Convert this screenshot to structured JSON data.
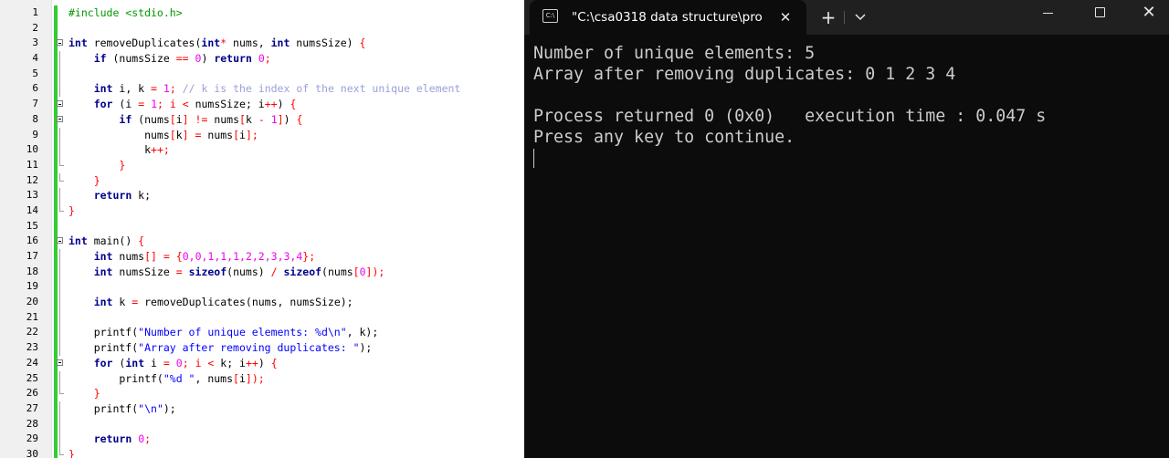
{
  "editor": {
    "lines": [
      {
        "n": "1",
        "fold": "none",
        "tokens": [
          {
            "t": "#include <stdio.h>",
            "c": "pp"
          }
        ]
      },
      {
        "n": "2",
        "fold": "none",
        "tokens": []
      },
      {
        "n": "3",
        "fold": "box",
        "tokens": [
          {
            "t": "int",
            "c": "kw"
          },
          {
            "t": " removeDuplicates(",
            "c": ""
          },
          {
            "t": "int",
            "c": "kw"
          },
          {
            "t": "*",
            "c": "op"
          },
          {
            "t": " nums, ",
            "c": ""
          },
          {
            "t": "int",
            "c": "kw"
          },
          {
            "t": " numsSize) ",
            "c": ""
          },
          {
            "t": "{",
            "c": "op"
          }
        ]
      },
      {
        "n": "4",
        "fold": "line",
        "tokens": [
          {
            "t": "    ",
            "c": ""
          },
          {
            "t": "if",
            "c": "kw"
          },
          {
            "t": " (numsSize ",
            "c": ""
          },
          {
            "t": "==",
            "c": "op"
          },
          {
            "t": " ",
            "c": ""
          },
          {
            "t": "0",
            "c": "num"
          },
          {
            "t": ") ",
            "c": ""
          },
          {
            "t": "return",
            "c": "kw"
          },
          {
            "t": " ",
            "c": ""
          },
          {
            "t": "0",
            "c": "num"
          },
          {
            "t": ";",
            "c": "op"
          }
        ]
      },
      {
        "n": "5",
        "fold": "line",
        "tokens": []
      },
      {
        "n": "6",
        "fold": "line",
        "tokens": [
          {
            "t": "    ",
            "c": ""
          },
          {
            "t": "int",
            "c": "kw"
          },
          {
            "t": " i, k ",
            "c": ""
          },
          {
            "t": "=",
            "c": "op"
          },
          {
            "t": " ",
            "c": ""
          },
          {
            "t": "1",
            "c": "num"
          },
          {
            "t": "; ",
            "c": "op"
          },
          {
            "t": "// k is the index of the next unique element",
            "c": "cm"
          }
        ]
      },
      {
        "n": "7",
        "fold": "box",
        "tokens": [
          {
            "t": "    ",
            "c": ""
          },
          {
            "t": "for",
            "c": "kw"
          },
          {
            "t": " (i ",
            "c": ""
          },
          {
            "t": "=",
            "c": "op"
          },
          {
            "t": " ",
            "c": ""
          },
          {
            "t": "1",
            "c": "num"
          },
          {
            "t": "; i ",
            "c": "op"
          },
          {
            "t": "<",
            "c": "op"
          },
          {
            "t": " numsSize; i",
            "c": ""
          },
          {
            "t": "++",
            "c": "op"
          },
          {
            "t": ") ",
            "c": ""
          },
          {
            "t": "{",
            "c": "op"
          }
        ]
      },
      {
        "n": "8",
        "fold": "box",
        "tokens": [
          {
            "t": "        ",
            "c": ""
          },
          {
            "t": "if",
            "c": "kw"
          },
          {
            "t": " (nums",
            "c": ""
          },
          {
            "t": "[",
            "c": "op"
          },
          {
            "t": "i",
            "c": ""
          },
          {
            "t": "]",
            "c": "op"
          },
          {
            "t": " ",
            "c": ""
          },
          {
            "t": "!=",
            "c": "op"
          },
          {
            "t": " nums",
            "c": ""
          },
          {
            "t": "[",
            "c": "op"
          },
          {
            "t": "k ",
            "c": ""
          },
          {
            "t": "-",
            "c": "op"
          },
          {
            "t": " ",
            "c": ""
          },
          {
            "t": "1",
            "c": "num"
          },
          {
            "t": "]",
            "c": "op"
          },
          {
            "t": ") ",
            "c": ""
          },
          {
            "t": "{",
            "c": "op"
          }
        ]
      },
      {
        "n": "9",
        "fold": "line",
        "tokens": [
          {
            "t": "            nums",
            "c": ""
          },
          {
            "t": "[",
            "c": "op"
          },
          {
            "t": "k",
            "c": ""
          },
          {
            "t": "]",
            "c": "op"
          },
          {
            "t": " ",
            "c": ""
          },
          {
            "t": "=",
            "c": "op"
          },
          {
            "t": " nums",
            "c": ""
          },
          {
            "t": "[",
            "c": "op"
          },
          {
            "t": "i",
            "c": ""
          },
          {
            "t": "]",
            "c": "op"
          },
          {
            "t": ";",
            "c": "op"
          }
        ]
      },
      {
        "n": "10",
        "fold": "line",
        "tokens": [
          {
            "t": "            k",
            "c": ""
          },
          {
            "t": "++;",
            "c": "op"
          }
        ]
      },
      {
        "n": "11",
        "fold": "end",
        "tokens": [
          {
            "t": "        ",
            "c": ""
          },
          {
            "t": "}",
            "c": "op"
          }
        ]
      },
      {
        "n": "12",
        "fold": "end",
        "tokens": [
          {
            "t": "    ",
            "c": ""
          },
          {
            "t": "}",
            "c": "op"
          }
        ]
      },
      {
        "n": "13",
        "fold": "line",
        "tokens": [
          {
            "t": "    ",
            "c": ""
          },
          {
            "t": "return",
            "c": "kw"
          },
          {
            "t": " k;",
            "c": ""
          }
        ]
      },
      {
        "n": "14",
        "fold": "end",
        "tokens": [
          {
            "t": "}",
            "c": "op"
          }
        ]
      },
      {
        "n": "15",
        "fold": "none",
        "tokens": []
      },
      {
        "n": "16",
        "fold": "box",
        "tokens": [
          {
            "t": "int",
            "c": "kw"
          },
          {
            "t": " main() ",
            "c": ""
          },
          {
            "t": "{",
            "c": "op"
          }
        ]
      },
      {
        "n": "17",
        "fold": "line",
        "tokens": [
          {
            "t": "    ",
            "c": ""
          },
          {
            "t": "int",
            "c": "kw"
          },
          {
            "t": " nums",
            "c": ""
          },
          {
            "t": "[]",
            "c": "op"
          },
          {
            "t": " ",
            "c": ""
          },
          {
            "t": "=",
            "c": "op"
          },
          {
            "t": " ",
            "c": ""
          },
          {
            "t": "{",
            "c": "op"
          },
          {
            "t": "0,0,1,1,1,2,2,3,3,4",
            "c": "num"
          },
          {
            "t": "};",
            "c": "op"
          }
        ]
      },
      {
        "n": "18",
        "fold": "line",
        "tokens": [
          {
            "t": "    ",
            "c": ""
          },
          {
            "t": "int",
            "c": "kw"
          },
          {
            "t": " numsSize ",
            "c": ""
          },
          {
            "t": "=",
            "c": "op"
          },
          {
            "t": " ",
            "c": ""
          },
          {
            "t": "sizeof",
            "c": "kw"
          },
          {
            "t": "(nums) ",
            "c": ""
          },
          {
            "t": "/",
            "c": "op"
          },
          {
            "t": " ",
            "c": ""
          },
          {
            "t": "sizeof",
            "c": "kw"
          },
          {
            "t": "(nums",
            "c": ""
          },
          {
            "t": "[",
            "c": "op"
          },
          {
            "t": "0",
            "c": "num"
          },
          {
            "t": "]",
            "c": "op"
          },
          {
            "t": ");",
            "c": "op"
          }
        ]
      },
      {
        "n": "19",
        "fold": "line",
        "tokens": []
      },
      {
        "n": "20",
        "fold": "line",
        "tokens": [
          {
            "t": "    ",
            "c": ""
          },
          {
            "t": "int",
            "c": "kw"
          },
          {
            "t": " k ",
            "c": ""
          },
          {
            "t": "=",
            "c": "op"
          },
          {
            "t": " removeDuplicates(nums, numsSize);",
            "c": ""
          }
        ]
      },
      {
        "n": "21",
        "fold": "line",
        "tokens": []
      },
      {
        "n": "22",
        "fold": "line",
        "tokens": [
          {
            "t": "    printf(",
            "c": ""
          },
          {
            "t": "\"Number of unique elements: %d\\n\"",
            "c": "str"
          },
          {
            "t": ", k);",
            "c": ""
          }
        ]
      },
      {
        "n": "23",
        "fold": "line",
        "tokens": [
          {
            "t": "    printf(",
            "c": ""
          },
          {
            "t": "\"Array after removing duplicates: \"",
            "c": "str"
          },
          {
            "t": ");",
            "c": ""
          }
        ]
      },
      {
        "n": "24",
        "fold": "box",
        "tokens": [
          {
            "t": "    ",
            "c": ""
          },
          {
            "t": "for",
            "c": "kw"
          },
          {
            "t": " (",
            "c": ""
          },
          {
            "t": "int",
            "c": "kw"
          },
          {
            "t": " i ",
            "c": ""
          },
          {
            "t": "=",
            "c": "op"
          },
          {
            "t": " ",
            "c": ""
          },
          {
            "t": "0",
            "c": "num"
          },
          {
            "t": "; i ",
            "c": "op"
          },
          {
            "t": "<",
            "c": "op"
          },
          {
            "t": " k; i",
            "c": ""
          },
          {
            "t": "++",
            "c": "op"
          },
          {
            "t": ") ",
            "c": ""
          },
          {
            "t": "{",
            "c": "op"
          }
        ]
      },
      {
        "n": "25",
        "fold": "line",
        "tokens": [
          {
            "t": "        printf(",
            "c": ""
          },
          {
            "t": "\"%d \"",
            "c": "str"
          },
          {
            "t": ", nums",
            "c": ""
          },
          {
            "t": "[",
            "c": "op"
          },
          {
            "t": "i",
            "c": ""
          },
          {
            "t": "]",
            "c": "op"
          },
          {
            "t": ");",
            "c": "op"
          }
        ]
      },
      {
        "n": "26",
        "fold": "end",
        "tokens": [
          {
            "t": "    ",
            "c": ""
          },
          {
            "t": "}",
            "c": "op"
          }
        ]
      },
      {
        "n": "27",
        "fold": "line",
        "tokens": [
          {
            "t": "    printf(",
            "c": ""
          },
          {
            "t": "\"\\n\"",
            "c": "str"
          },
          {
            "t": ");",
            "c": ""
          }
        ]
      },
      {
        "n": "28",
        "fold": "line",
        "tokens": []
      },
      {
        "n": "29",
        "fold": "line",
        "tokens": [
          {
            "t": "    ",
            "c": ""
          },
          {
            "t": "return",
            "c": "kw"
          },
          {
            "t": " ",
            "c": ""
          },
          {
            "t": "0",
            "c": "num"
          },
          {
            "t": ";",
            "c": "op"
          }
        ]
      },
      {
        "n": "30",
        "fold": "end",
        "tokens": [
          {
            "t": "}",
            "c": "op"
          }
        ]
      }
    ]
  },
  "console": {
    "tab_title": "\"C:\\csa0318 data structure\\pro",
    "tab_icon_text": "C:\\",
    "new_tab_symbol": "+",
    "close_symbol": "✕",
    "lines": [
      "Number of unique elements: 5",
      "Array after removing duplicates: 0 1 2 3 4",
      "",
      "Process returned 0 (0x0)   execution time : 0.047 s",
      "Press any key to continue."
    ]
  }
}
